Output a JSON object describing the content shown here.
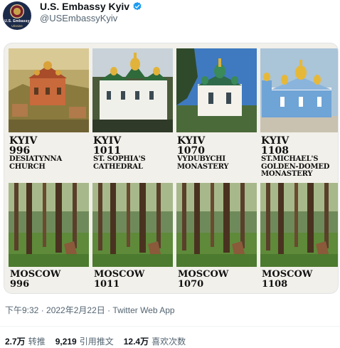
{
  "account": {
    "display_name": "U.S. Embassy Kyiv",
    "handle": "@USEmbassyKyiv",
    "avatar_line1": "U.S. Embassy",
    "avatar_line2": "Ukraine",
    "verified_icon": "verified-badge-icon",
    "verified_color": "#1d9bf0"
  },
  "image": {
    "kyiv": [
      {
        "city": "KYIV",
        "year": "996",
        "church_lines": [
          "DESIATYNNA",
          "CHURCH"
        ]
      },
      {
        "city": "KYIV",
        "year": "1011",
        "church_lines": [
          "ST. SOPHIA'S",
          "CATHEDRAL"
        ]
      },
      {
        "city": "KYIV",
        "year": "1070",
        "church_lines": [
          "VYDUBYCHI",
          "MONASTERY"
        ]
      },
      {
        "city": "KYIV",
        "year": "1108",
        "church_lines": [
          "ST.MICHAEL'S",
          "GOLDEN-DOMED",
          "MONASTERY"
        ]
      }
    ],
    "moscow": [
      {
        "city": "MOSCOW",
        "year": "996"
      },
      {
        "city": "MOSCOW",
        "year": "1011"
      },
      {
        "city": "MOSCOW",
        "year": "1070"
      },
      {
        "city": "MOSCOW",
        "year": "1108"
      }
    ]
  },
  "meta": {
    "timestamp": "下午9:32 · 2022年2月22日 · Twitter Web App"
  },
  "stats": {
    "retweets_count": "2.7万",
    "retweets_label": "转推",
    "quotes_count": "9,219",
    "quotes_label": "引用推文",
    "likes_count": "12.4万",
    "likes_label": "喜欢次数"
  },
  "colors": {
    "text_primary": "#0f1419",
    "text_secondary": "#536471",
    "card_bg": "#f2f0ea"
  }
}
